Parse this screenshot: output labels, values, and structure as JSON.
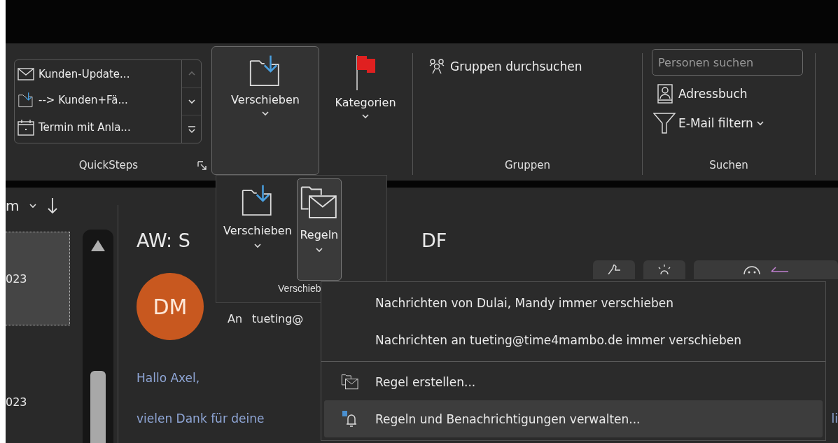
{
  "ribbon": {
    "quicksteps": {
      "label": "QuickSteps",
      "items": [
        {
          "kind": "mail",
          "label": "Kunden-Update..."
        },
        {
          "kind": "move",
          "label": "--> Kunden+Fä..."
        },
        {
          "kind": "calendar",
          "label": "Termin mit Anla..."
        }
      ]
    },
    "move_button": {
      "label": "Verschieben",
      "selected": true
    },
    "categories_button": {
      "label": "Kategorien"
    },
    "groups": {
      "label": "Gruppen",
      "search_groups": "Gruppen durchsuchen"
    },
    "search": {
      "label": "Suchen",
      "people_search": {
        "placeholder": "Personen suchen"
      },
      "address_book": "Adressbuch",
      "filter_mail": "E-Mail filtern"
    }
  },
  "message_list": {
    "sort_label": "m",
    "items": [
      {
        "date": "023",
        "selected": true
      },
      {
        "date": "023",
        "selected": false
      }
    ]
  },
  "reading_pane": {
    "subject_left": "AW: S",
    "subject_right": "DF",
    "avatar": "DM",
    "to_label": "An",
    "to_value": "tueting@",
    "greeting": "Hallo Axel,",
    "body_line": "vielen Dank für deine",
    "body_right": "li"
  },
  "move_popup": {
    "buttons": [
      {
        "kind": "move",
        "label": "Verschieben",
        "selected": false
      },
      {
        "kind": "rules",
        "label": "Regeln",
        "selected": true
      }
    ],
    "group_label": "Verschieb"
  },
  "rules_menu": {
    "items": [
      {
        "kind": "text",
        "label": "Nachrichten von Dulai, Mandy immer verschieben",
        "highlighted": false
      },
      {
        "kind": "text",
        "label": "Nachrichten an tueting@time4mambo.de immer verschieben",
        "highlighted": false
      },
      {
        "kind": "separator"
      },
      {
        "kind": "create",
        "label": "Regel erstellen...",
        "highlighted": false
      },
      {
        "kind": "manage",
        "label": "Regeln und Benachrichtigungen verwalten...",
        "highlighted": true
      }
    ]
  }
}
